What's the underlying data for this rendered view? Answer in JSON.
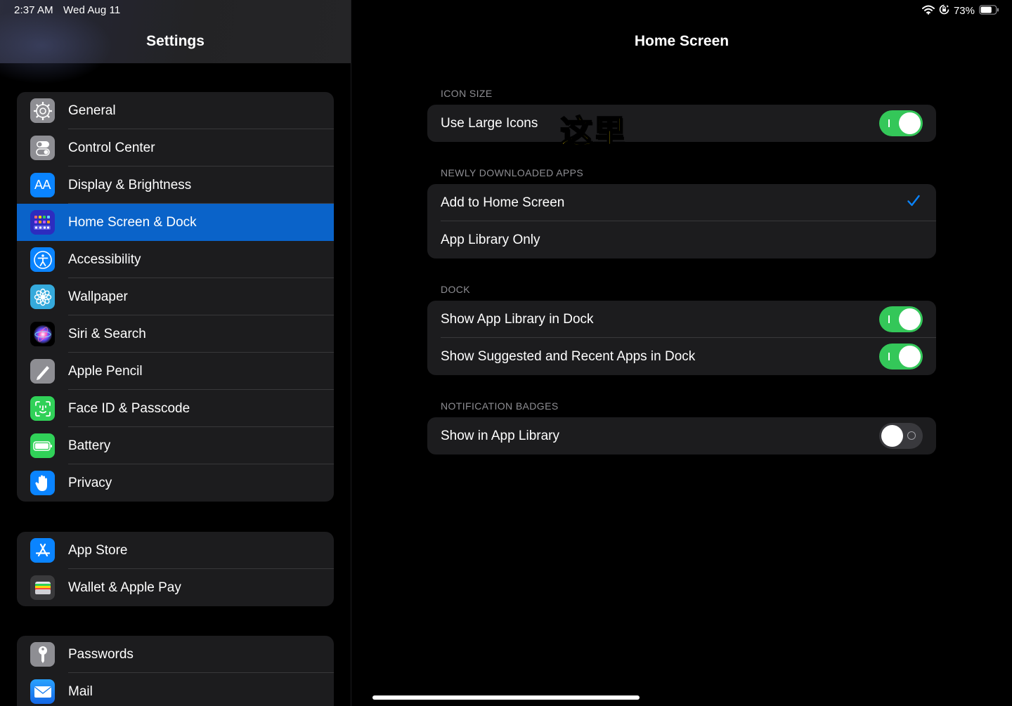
{
  "status_bar": {
    "time": "2:37 AM",
    "date": "Wed Aug 11",
    "battery_percent": "73%",
    "battery_level": 0.73
  },
  "sidebar": {
    "title": "Settings",
    "groups": [
      {
        "items": [
          {
            "label": "General",
            "icon": "gear-icon",
            "color": "#8e8e93"
          },
          {
            "label": "Control Center",
            "icon": "toggles-icon",
            "color": "#8e8e93"
          },
          {
            "label": "Display & Brightness",
            "icon": "text-size-icon",
            "color": "#0a84ff"
          },
          {
            "label": "Home Screen & Dock",
            "icon": "app-grid-icon",
            "color": "#2c2cbf",
            "selected": true
          },
          {
            "label": "Accessibility",
            "icon": "accessibility-icon",
            "color": "#0a84ff"
          },
          {
            "label": "Wallpaper",
            "icon": "flower-icon",
            "color": "#35aadc"
          },
          {
            "label": "Siri & Search",
            "icon": "siri-icon",
            "color": "#000000"
          },
          {
            "label": "Apple Pencil",
            "icon": "pencil-icon",
            "color": "#8e8e93"
          },
          {
            "label": "Face ID & Passcode",
            "icon": "face-id-icon",
            "color": "#30d158"
          },
          {
            "label": "Battery",
            "icon": "battery-icon",
            "color": "#30d158"
          },
          {
            "label": "Privacy",
            "icon": "hand-icon",
            "color": "#0a84ff"
          }
        ]
      },
      {
        "items": [
          {
            "label": "App Store",
            "icon": "app-store-icon",
            "color": "#0a84ff"
          },
          {
            "label": "Wallet & Apple Pay",
            "icon": "wallet-icon",
            "color": "#3a3a3c"
          }
        ]
      },
      {
        "items": [
          {
            "label": "Passwords",
            "icon": "key-icon",
            "color": "#8e8e93"
          },
          {
            "label": "Mail",
            "icon": "mail-icon",
            "color": "#1e90ff"
          }
        ]
      }
    ]
  },
  "detail": {
    "title": "Home Screen",
    "overlay_text": "这里",
    "sections": [
      {
        "header": "ICON SIZE",
        "rows": [
          {
            "label": "Use Large Icons",
            "toggle": true
          }
        ]
      },
      {
        "header": "NEWLY DOWNLOADED APPS",
        "rows": [
          {
            "label": "Add to Home Screen",
            "checked": true
          },
          {
            "label": "App Library Only",
            "checked": false
          }
        ]
      },
      {
        "header": "DOCK",
        "rows": [
          {
            "label": "Show App Library in Dock",
            "toggle": true
          },
          {
            "label": "Show Suggested and Recent Apps in Dock",
            "toggle": true
          }
        ]
      },
      {
        "header": "NOTIFICATION BADGES",
        "rows": [
          {
            "label": "Show in App Library",
            "toggle": false
          }
        ]
      }
    ]
  },
  "colors": {
    "accent": "#0a84ff",
    "selected_row": "#0a63c9",
    "toggle_on": "#34c759",
    "toggle_off": "#39393d",
    "cell": "#1c1c1e"
  }
}
